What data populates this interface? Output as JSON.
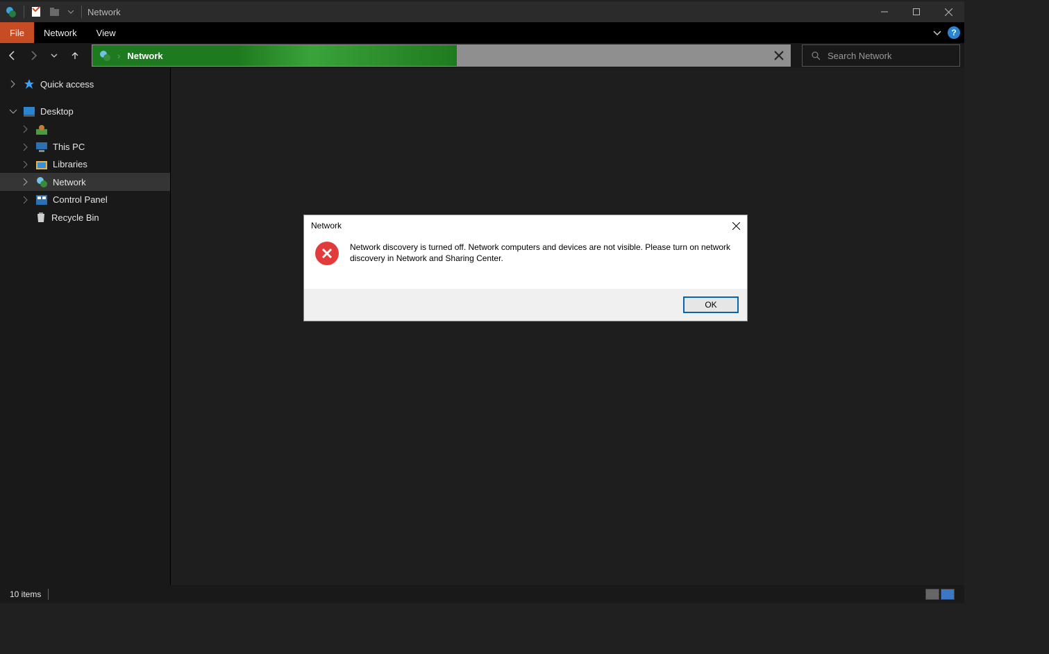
{
  "window": {
    "title": "Network"
  },
  "ribbon": {
    "file": "File",
    "tabs": [
      "Network",
      "View"
    ],
    "help": "?"
  },
  "nav": {
    "address": "Network",
    "search_placeholder": "Search Network"
  },
  "sidebar": {
    "quick_access": "Quick access",
    "desktop": "Desktop",
    "this_pc": "This PC",
    "libraries": "Libraries",
    "network": "Network",
    "control_panel": "Control Panel",
    "recycle_bin": "Recycle Bin",
    "user_folder": ""
  },
  "statusbar": {
    "items": "10 items"
  },
  "dialog": {
    "title": "Network",
    "message": "Network discovery is turned off. Network computers and devices are not visible. Please turn on network discovery in Network and Sharing Center.",
    "ok": "OK"
  }
}
